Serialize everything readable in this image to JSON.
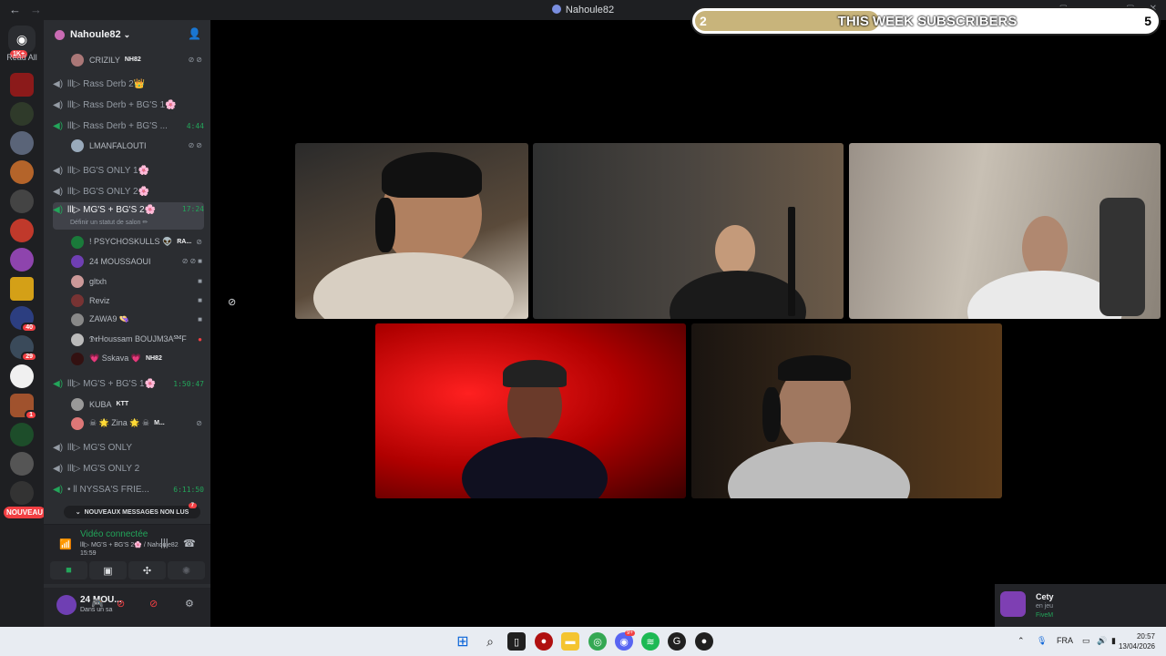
{
  "window": {
    "title": "Nahoule82",
    "back": "←",
    "forward": "→"
  },
  "rail": {
    "home_badge": "1K+",
    "read_all": "Read All",
    "nouveau": "NOUVEAU",
    "badges": {
      "s13": "40",
      "s14": "29",
      "s17": "1"
    }
  },
  "guild": {
    "name": "Nahoule82",
    "chevron": "⌄"
  },
  "channels": [
    {
      "name": "lll▷ Rass Derb 2👑",
      "time": ""
    },
    {
      "name": "lll▷ Rass Derb + BG'S 1🌸",
      "time": ""
    },
    {
      "name": "lll▷ Rass Derb + BG'S ...",
      "time": "4:44"
    },
    {
      "name": "lll▷ BG'S ONLY 1🌸",
      "time": ""
    },
    {
      "name": "lll▷ BG'S ONLY 2🌸",
      "time": ""
    },
    {
      "name": "lll▷ MG'S + BG'S 2🌸",
      "time": "17:24",
      "status": "Définir un statut de salon ✏"
    },
    {
      "name": "lll▷ MG'S + BG'S 1🌸",
      "time": "1:50:47"
    },
    {
      "name": "lll▷ MG'S ONLY",
      "time": ""
    },
    {
      "name": "lll▷ MG'S ONLY 2",
      "time": ""
    },
    {
      "name": "• ll NYSSA'S FRIE...",
      "time": "6:11:50"
    }
  ],
  "users": {
    "crizily": {
      "name": "CRIZILY",
      "tag": "NH82"
    },
    "lmanfalouti": {
      "name": "LMANFALOUTI"
    },
    "psychoskulls": {
      "name": "! PSYCHOSKULLS 👽",
      "tag": "RA..."
    },
    "moussaoui": {
      "name": "24 MOUSSAOUI"
    },
    "gltxh": {
      "name": "gltxh"
    },
    "reviz": {
      "name": "Reviz"
    },
    "zawa9": {
      "name": "ZAWA9 👒"
    },
    "drhoussam": {
      "name": "𝕯𝖗Houssam BOUJM3A℠F"
    },
    "sskava": {
      "name": "💗 Sskava 💗",
      "tag": "NH82"
    },
    "kuba": {
      "name": "KUBA",
      "tag": "KTT"
    },
    "zina": {
      "name": "☠ 🌟 Zina 🌟 ☠",
      "tag": "M..."
    }
  },
  "new_messages": {
    "label": "NOUVEAUX MESSAGES NON LUS",
    "count": "7"
  },
  "voice": {
    "status": "Vidéo connectée",
    "channel": "lll▷ MG'S + BG'S 2🌸 / Nahoule82",
    "time": "15:59"
  },
  "me": {
    "name": "24 MOU...",
    "status": "Dans un sa"
  },
  "overlay": {
    "left": "2",
    "label": "THIS WEEK SUBSCRIBERS",
    "right": "5",
    "progress": 0.4
  },
  "toast": {
    "name": "Cety",
    "status": "en jeu",
    "game": "FiveM"
  },
  "taskbar": {
    "lang": "FRA",
    "time": "20:57",
    "date": "13/04/2026",
    "discord_badge": "9+"
  },
  "colors": {
    "accent_green": "#23a55a",
    "badge_red": "#f23f43",
    "sidebar_bg": "#2b2d31",
    "rail_bg": "#1e1f22"
  }
}
